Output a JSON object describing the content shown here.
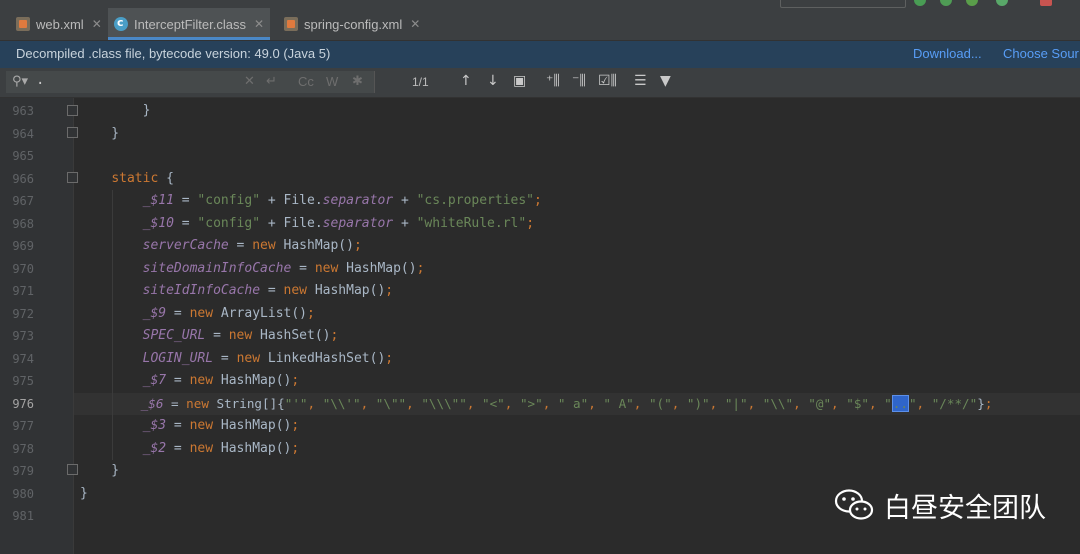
{
  "tabs": [
    {
      "label": "web.xml",
      "icon": "xml-file-icon",
      "active": false
    },
    {
      "label": "InterceptFilter.class",
      "icon": "class-file-icon",
      "active": true
    },
    {
      "label": "spring-config.xml",
      "icon": "xml-file-icon",
      "active": false
    }
  ],
  "banner": {
    "message": "Decompiled .class file, bytecode version: 49.0 (Java 5)",
    "download_label": "Download...",
    "choose_sources_label": "Choose Sour"
  },
  "search": {
    "value": ".",
    "match_count": "1/1"
  },
  "editor": {
    "current_line": "976",
    "line_numbers": [
      "963",
      "964",
      "965",
      "966",
      "967",
      "968",
      "969",
      "970",
      "971",
      "972",
      "973",
      "974",
      "975",
      "976",
      "977",
      "978",
      "979",
      "980",
      "981"
    ]
  },
  "watermark": {
    "text": "白昼安全团队"
  },
  "colors": {
    "accent": "#4a88c7",
    "keyword": "#cc7832",
    "string": "#6a8759",
    "field": "#9876aa",
    "banner_bg": "#27415a",
    "link": "#589df6"
  }
}
